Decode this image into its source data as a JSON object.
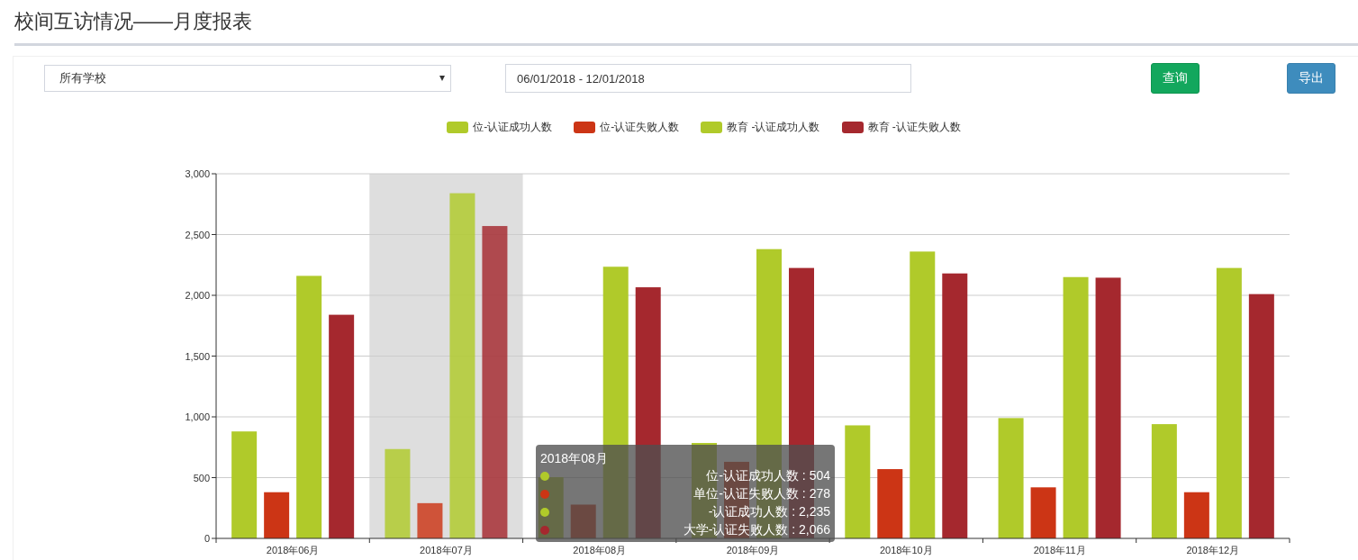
{
  "page_title": "校间互访情况——月度报表",
  "filters": {
    "school_select": {
      "value": "所有学校"
    },
    "date_range": {
      "value": "06/01/2018 - 12/01/2018"
    },
    "buttons": [
      {
        "label": "查询",
        "kind": "primary"
      },
      {
        "label": "导出",
        "kind": "export"
      }
    ]
  },
  "chart": {
    "chart_data": {
      "type": "bar",
      "categories": [
        "2018年06月",
        "2018年07月",
        "2018年08月",
        "2018年09月",
        "2018年10月",
        "2018年11月",
        "2018年12月"
      ],
      "ylim": [
        0,
        3000
      ],
      "yticks": [
        {
          "value": 0,
          "label": "0"
        },
        {
          "value": 500,
          "label": "500"
        },
        {
          "value": 1000,
          "label": "1,000"
        },
        {
          "value": 1500,
          "label": "1,500"
        },
        {
          "value": 2000,
          "label": "2,000"
        },
        {
          "value": 2500,
          "label": "2,500"
        },
        {
          "value": 3000,
          "label": "3,000"
        }
      ],
      "grid": true,
      "legend": true,
      "bands": [
        {
          "axis": "x",
          "from": "2018年07月",
          "to": "2018年07月",
          "color": "#dedede"
        }
      ],
      "series": [
        {
          "name": "位-认证成功人数",
          "color": "#b0ca2a",
          "values": [
            880,
            735,
            504,
            785,
            930,
            990,
            940
          ]
        },
        {
          "name": "位-认证失败人数",
          "color": "#cc3515",
          "values": [
            380,
            290,
            278,
            630,
            570,
            420,
            380
          ]
        },
        {
          "name": "教育 -认证成功人数",
          "color": "#b0ca2a",
          "values": [
            2160,
            2840,
            2235,
            2380,
            2360,
            2150,
            2225
          ]
        },
        {
          "name": "教育 -认证失败人数",
          "color": "#a5282e",
          "values": [
            1840,
            2570,
            2066,
            2225,
            2180,
            2145,
            2010
          ]
        }
      ]
    },
    "tooltip": {
      "title": "2018年08月",
      "items": [
        {
          "text": "位-认证成功人数 : 504",
          "color": "#b0ca2a"
        },
        {
          "text": "单位-认证失败人数 : 278",
          "color": "#cc3515"
        },
        {
          "text": "-认证成功人数 : 2,235",
          "color": "#b0ca2a"
        },
        {
          "text": "大学-认证失败人数 : 2,066",
          "color": "#a5282e"
        }
      ]
    }
  }
}
